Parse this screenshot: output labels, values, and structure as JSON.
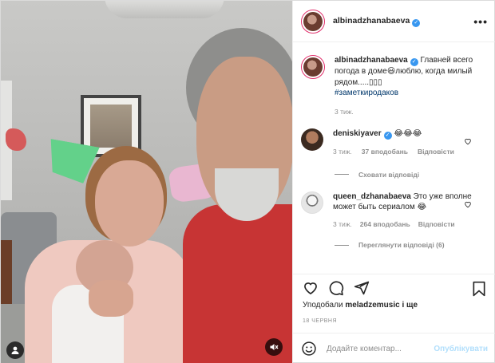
{
  "header": {
    "username": "albinadzhanabaeva",
    "more_label": "•••"
  },
  "caption": {
    "username": "albinadzhanabaeva",
    "text": "Главней всего погода в доме😃люблю, когда милый рядом.....",
    "suffix": "▯▯▯",
    "hashtag": "#заметкиродаков",
    "time": "3 тиж."
  },
  "comments": [
    {
      "username": "deniskiyaver",
      "text": "😂😂😂",
      "time": "3 тиж.",
      "likes": "37 вподобань",
      "reply": "Відповісти",
      "replies_label": "Сховати відповіді"
    },
    {
      "username": "queen_dzhanabaeva",
      "text": "Это уже вполне может быть сериалом 😂",
      "time": "3 тиж.",
      "likes": "264 вподобань",
      "reply": "Відповісти",
      "replies_label": "Переглянути відповіді (6)"
    }
  ],
  "likes": {
    "prefix": "Уподобали",
    "user": "meladzemusic",
    "suffix": "і ще"
  },
  "date": "18 червня",
  "add_comment": {
    "placeholder": "Додайте коментар...",
    "post_label": "Опублікувати"
  },
  "icons": {
    "verified": "verified-badge",
    "heart": "heart-icon",
    "comment": "comment-icon",
    "share": "share-icon",
    "bookmark": "bookmark-icon",
    "emoji": "emoji-icon",
    "user_tag": "user-tag-icon",
    "mute": "mute-icon"
  },
  "colors": {
    "verified": "#3897f0",
    "post_button_disabled": "#b2dffc",
    "hashtag": "#00376b",
    "muted_text": "#8e8e8e"
  }
}
